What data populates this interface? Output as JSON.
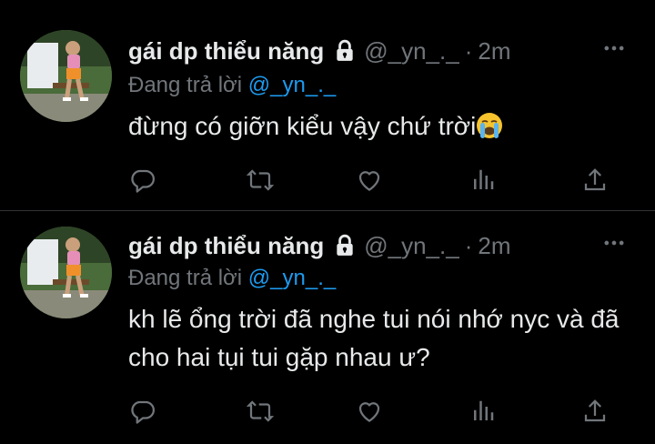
{
  "tweets": [
    {
      "display_name": "gái dp thiểu năng",
      "handle": "@_yn_._",
      "separator": "·",
      "time": "2m",
      "reply_prefix": "Đang trả lời ",
      "reply_handle": "@_yn_._",
      "text": "đừng có giỡn kiểu vậy chứ trời",
      "text_emoji": "loudly-crying-face-emoji"
    },
    {
      "display_name": "gái dp thiểu năng",
      "handle": "@_yn_._",
      "separator": "·",
      "time": "2m",
      "reply_prefix": "Đang trả lời ",
      "reply_handle": "@_yn_._",
      "text": "kh lẽ ổng trời đã nghe tui nói nhớ nyc và đã cho hai tụi tui gặp nhau ư?",
      "text_emoji": ""
    }
  ],
  "icons": {
    "lock": "lock-icon",
    "more": "more-options-icon",
    "reply": "reply-icon",
    "retweet": "retweet-icon",
    "like": "heart-icon",
    "views": "views-icon",
    "share": "share-icon"
  },
  "colors": {
    "background": "#000000",
    "text_primary": "#e7e9ea",
    "text_secondary": "#71767b",
    "accent": "#1d9bf0",
    "divider": "#2f3336"
  }
}
